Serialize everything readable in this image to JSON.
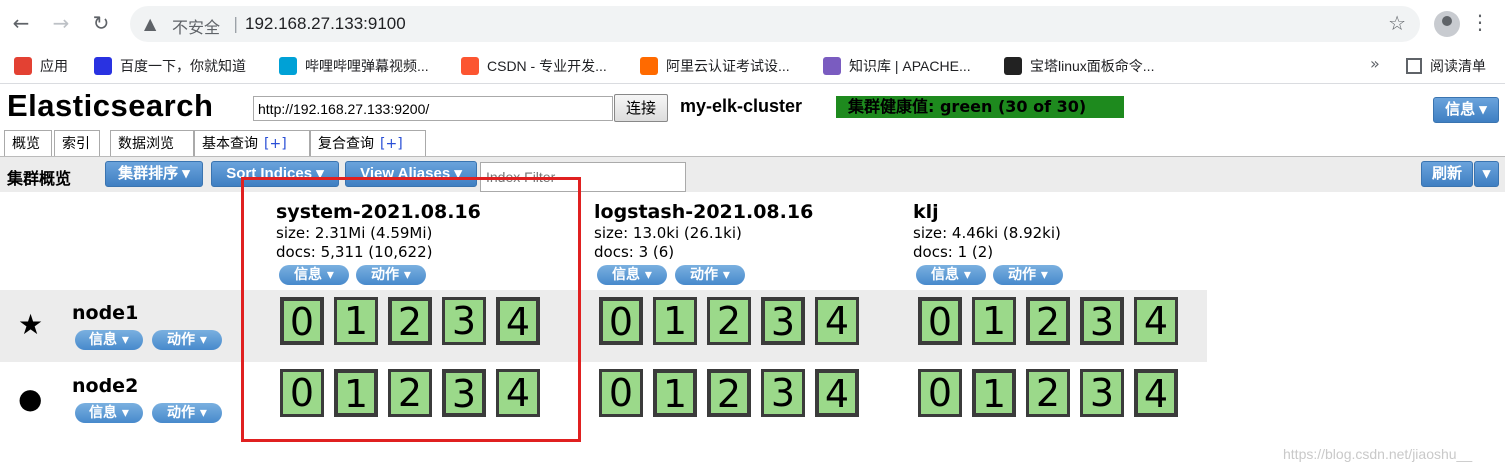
{
  "browser": {
    "insecure_label": "不安全",
    "separator": "|",
    "url": "192.168.27.133:9100",
    "bookmarks": [
      {
        "label": "应用",
        "color": "#e34133"
      },
      {
        "label": "百度一下，你就知道",
        "color": "#2932e1"
      },
      {
        "label": "哔哩哔哩弹幕视频...",
        "color": "#00a1d6"
      },
      {
        "label": "CSDN - 专业开发...",
        "color": "#fc5531"
      },
      {
        "label": "阿里云认证考试设...",
        "color": "#ff6a00"
      },
      {
        "label": "知识库 | APACHE...",
        "color": "#7a5cc0"
      },
      {
        "label": "宝塔linux面板命令...",
        "color": "#222222"
      }
    ],
    "more": "»",
    "reading_list": "阅读清单"
  },
  "app": {
    "title": "Elasticsearch",
    "connect_url": "http://192.168.27.133:9200/",
    "connect_button": "连接",
    "cluster_name": "my-elk-cluster",
    "health": "集群健康值: green (30 of 30)",
    "health_color": "#1e8a1e",
    "info_button": "信息 ▾",
    "tabs": [
      {
        "label": "概览",
        "plus": ""
      },
      {
        "label": "索引",
        "plus": ""
      },
      {
        "label": "数据浏览",
        "plus": ""
      },
      {
        "label": "基本查询",
        "plus": "[+]"
      },
      {
        "label": "复合查询",
        "plus": "[+]"
      }
    ],
    "overview_title": "集群概览",
    "sort_cluster": "集群排序 ▾",
    "sort_indices": "Sort Indices ▾",
    "view_aliases": "View Aliases ▾",
    "index_filter_placeholder": "Index Filter",
    "refresh": "刷新",
    "refresh_caret": "▾"
  },
  "indices": [
    {
      "name": "system-2021.08.16",
      "size": "size: 2.31Mi (4.59Mi)",
      "docs": "docs: 5,311 (10,622)"
    },
    {
      "name": "logstash-2021.08.16",
      "size": "size: 13.0ki (26.1ki)",
      "docs": "docs: 3 (6)"
    },
    {
      "name": "klj",
      "size": "size: 4.46ki (8.92ki)",
      "docs": "docs: 1 (2)"
    }
  ],
  "pill_labels": {
    "info": "信息 ▾",
    "action": "动作 ▾"
  },
  "nodes": [
    {
      "name": "node1",
      "icon": "★"
    },
    {
      "name": "node2",
      "icon": "●"
    }
  ],
  "shards": [
    "0",
    "1",
    "2",
    "3",
    "4"
  ],
  "watermark": "https://blog.csdn.net/jiaoshu__"
}
